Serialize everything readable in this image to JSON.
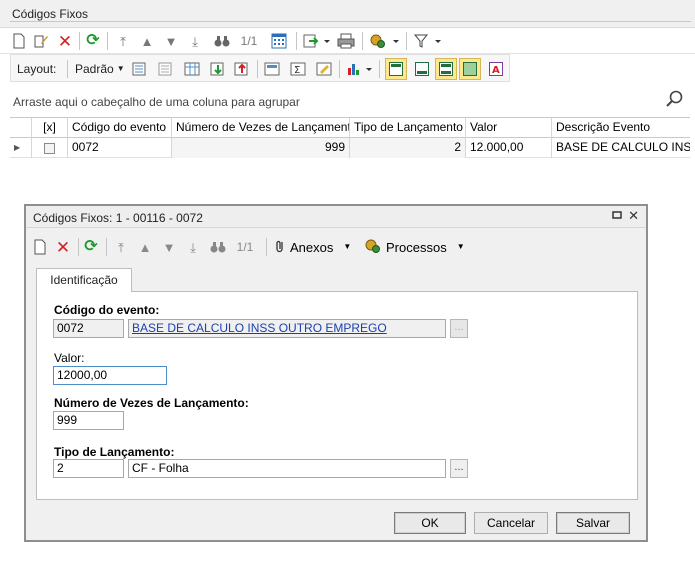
{
  "window": {
    "title": "Códigos Fixos"
  },
  "toolbar1": {
    "page_indicator": "1/1"
  },
  "toolbar2": {
    "layout_label": "Layout:",
    "preset_label": "Padrão"
  },
  "group_hint": "Arraste aqui o cabeçalho de uma coluna para agrupar",
  "grid": {
    "headers": [
      "[x]",
      "Código do evento",
      "Número de Vezes de Lançamento",
      "Tipo de Lançamento",
      "Valor",
      "Descrição Evento"
    ],
    "rows": [
      {
        "code": "0072",
        "times": "999",
        "type": "2",
        "value": "12.000,00",
        "desc": "BASE DE CALCULO INSS OUTRO EMPREGO"
      }
    ]
  },
  "dialog": {
    "title": "Códigos Fixos: 1 - 00116 - 0072",
    "page_indicator": "1/1",
    "attachments_label": "Anexos",
    "processes_label": "Processos",
    "tab_label": "Identificação",
    "fields": {
      "event_code_label": "Código do evento:",
      "event_code": "0072",
      "event_desc": "BASE DE CALCULO INSS OUTRO EMPREGO",
      "value_label": "Valor:",
      "value": "12000,00",
      "times_label": "Número de Vezes de Lançamento:",
      "times": "999",
      "type_label": "Tipo de Lançamento:",
      "type_code": "2",
      "type_desc": "CF - Folha"
    },
    "buttons": {
      "ok": "OK",
      "cancel": "Cancelar",
      "save": "Salvar"
    }
  },
  "colors": {
    "highlight": "#fde88c",
    "link": "#1a3fb0",
    "delete_red": "#d42020",
    "refresh_green": "#1f9a2e"
  }
}
